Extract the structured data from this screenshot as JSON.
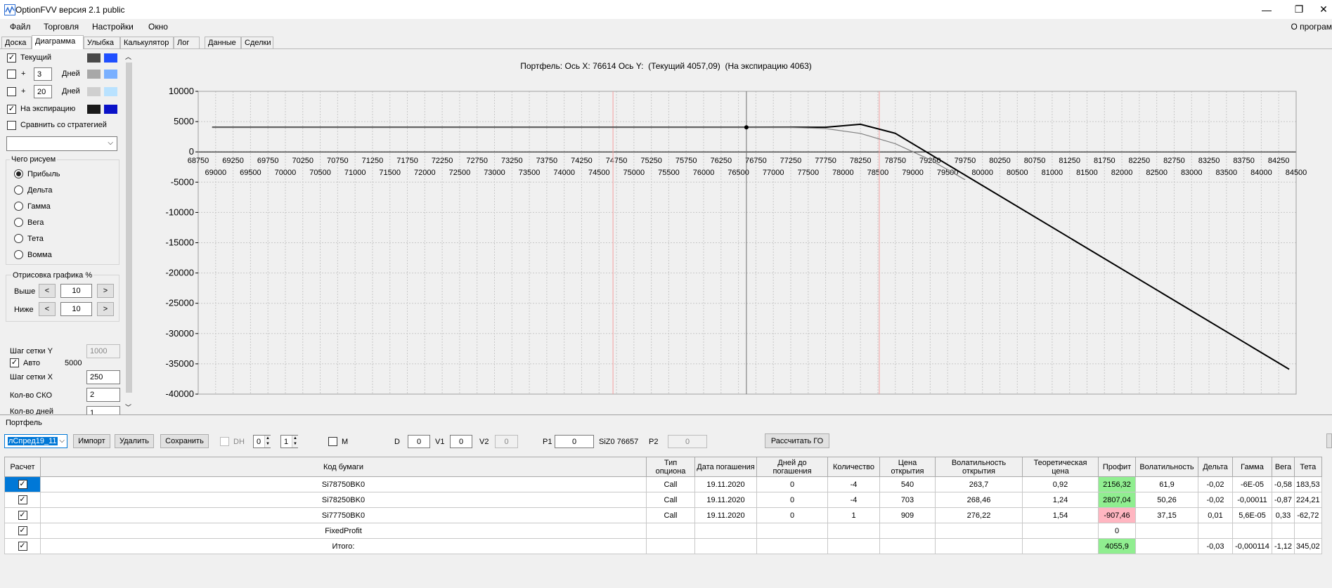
{
  "window": {
    "title": "OptionFVV версия 2.1 public",
    "minimize": "—",
    "maximize": "❐",
    "close": "✕"
  },
  "menu": {
    "items": [
      "Файл",
      "Торговля",
      "Настройки",
      "Окно"
    ],
    "about": "О програм"
  },
  "tabs": [
    "Доска",
    "Диаграмма",
    "Улыбка",
    "Калькулятор",
    "Лог",
    "Данные",
    "Сделки"
  ],
  "active_tab": "Диаграмма",
  "left_panel": {
    "rows": [
      {
        "checked": true,
        "label": "Текущий",
        "colors": [
          "#4a4a4a",
          "#1f4fff"
        ]
      },
      {
        "checked": false,
        "plus": "+",
        "days_value": "3",
        "days_label": "Дней",
        "colors": [
          "#a8a8a8",
          "#7ab0ff"
        ]
      },
      {
        "checked": false,
        "plus": "+",
        "days_value": "20",
        "days_label": "Дней",
        "colors": [
          "#cfcfcf",
          "#b9e2ff"
        ]
      },
      {
        "checked": true,
        "label": "На экспирацию",
        "colors": [
          "#1a1a1a",
          "#0a12c8"
        ]
      }
    ],
    "compare_label": "Сравнить со стратегией",
    "compare_value": "",
    "what_group": {
      "title": "Чего рисуем",
      "options": [
        "Прибыль",
        "Дельта",
        "Гамма",
        "Вега",
        "Тета",
        "Вомма"
      ],
      "selected": "Прибыль"
    },
    "draw_group": {
      "title": "Отрисовка графика %",
      "above_label": "Выше",
      "above_value": "10",
      "below_label": "Ниже",
      "below_value": "10",
      "dec": "<",
      "inc": ">"
    },
    "grid_y_label": "Шаг сетки Y",
    "grid_y_value": "1000",
    "auto_checked": true,
    "auto_label": "Авто",
    "auto_value": "5000",
    "grid_x_label": "Шаг сетки X",
    "grid_x_value": "250",
    "sko_label": "Кол-во СКО",
    "sko_value": "2",
    "days_label": "Кол-во дней",
    "days_value": "1"
  },
  "chart_title": {
    "prefix": "Портфель: Ось X:",
    "x": "76614",
    "y_label": "Ось Y:",
    "current": "(Текущий 4057,09)",
    "expiration": "(На экспирацию 4063)"
  },
  "chart_data": {
    "type": "line",
    "xlim": [
      68750,
      84500
    ],
    "ylim": [
      -40000,
      10000
    ],
    "y_ticks": [
      10000,
      5000,
      0,
      -5000,
      -10000,
      -15000,
      -20000,
      -25000,
      -30000,
      -35000,
      -40000
    ],
    "x_ticks_upper": [
      68750,
      69250,
      69750,
      70250,
      70750,
      71250,
      71750,
      72250,
      72750,
      73250,
      73750,
      74250,
      74750,
      75250,
      75750,
      76250,
      76750,
      77250,
      77750,
      78250,
      78750,
      79250,
      79750,
      80250,
      80750,
      81250,
      81750,
      82250,
      82750,
      83250,
      83750,
      84250
    ],
    "x_ticks_lower": [
      69000,
      69500,
      70000,
      70500,
      71000,
      71500,
      72000,
      72500,
      73000,
      73500,
      74000,
      74500,
      75000,
      75500,
      76000,
      76500,
      77000,
      77500,
      78000,
      78500,
      79000,
      79500,
      80000,
      80500,
      81000,
      81500,
      82000,
      82500,
      83000,
      83500,
      84000,
      84500
    ],
    "grid": true,
    "series": [
      {
        "color": "#000000",
        "x": [
          68950,
          77750,
          78250,
          78750,
          84400
        ],
        "y": [
          4063,
          4063,
          4563,
          3063,
          -35900
        ]
      },
      {
        "color": "#808080",
        "x": [
          68950,
          76614,
          77250,
          77750,
          78250,
          78750,
          79250,
          79750
        ],
        "y": [
          4057,
          4057,
          4030,
          3850,
          3050,
          1350,
          -1300,
          -4600
        ]
      }
    ],
    "markers": [
      {
        "x": 76614,
        "y": 4057
      }
    ],
    "vlines": [
      {
        "x": 74700,
        "color": "#f4a0a0"
      },
      {
        "x": 76614,
        "color": "#707070"
      },
      {
        "x": 78520,
        "color": "#f4a0a0"
      }
    ]
  },
  "portfolio": {
    "label": "Портфель",
    "combo_value": "лСпред19_11",
    "import_btn": "Импорт",
    "delete_btn": "Удалить",
    "save_btn": "Сохранить",
    "dh_label": "DH",
    "spin1": "0",
    "spin2": "1",
    "m_label": "M",
    "d_label": "D",
    "d_value": "0",
    "v1_label": "V1",
    "v1_value": "0",
    "v2_label": "V2",
    "v2_value": "0",
    "p1_label": "P1",
    "p1_value": "0",
    "siz_text": "SiZ0 76657",
    "p2_label": "P2",
    "p2_value": "0",
    "calc_btn": "Рассчитать ГО"
  },
  "table": {
    "headers": [
      "Расчет",
      "Код бумаги",
      "Тип опциона",
      "Дата погашения",
      "Дней до погашения",
      "Количество",
      "Цена открытия",
      "Волатильность открытия",
      "Теоретическая цена",
      "Профит",
      "Волатильность",
      "Дельта",
      "Гамма",
      "Вега",
      "Тета"
    ],
    "rows": [
      {
        "code": "Si78750BK0",
        "type": "Call",
        "date": "19.11.2020",
        "days": "0",
        "qty": "-4",
        "price": "540",
        "vol_open": "263,7",
        "theo": "0,92",
        "profit": "2156,32",
        "profit_color": "green",
        "vol": "61,9",
        "delta": "-0,02",
        "gamma": "-6E-05",
        "vega": "-0,58",
        "theta": "183,53"
      },
      {
        "code": "Si78250BK0",
        "type": "Call",
        "date": "19.11.2020",
        "days": "0",
        "qty": "-4",
        "price": "703",
        "vol_open": "268,46",
        "theo": "1,24",
        "profit": "2807,04",
        "profit_color": "green",
        "vol": "50,26",
        "delta": "-0,02",
        "gamma": "-0,00011",
        "vega": "-0,87",
        "theta": "224,21"
      },
      {
        "code": "Si77750BK0",
        "type": "Call",
        "date": "19.11.2020",
        "days": "0",
        "qty": "1",
        "price": "909",
        "vol_open": "276,22",
        "theo": "1,54",
        "profit": "-907,46",
        "profit_color": "pink",
        "vol": "37,15",
        "delta": "0,01",
        "gamma": "5,6E-05",
        "vega": "0,33",
        "theta": "-62,72"
      },
      {
        "code": "FixedProfit",
        "type": "",
        "date": "",
        "days": "",
        "qty": "",
        "price": "",
        "vol_open": "",
        "theo": "",
        "profit": "0",
        "profit_color": "",
        "vol": "",
        "delta": "",
        "gamma": "",
        "vega": "",
        "theta": ""
      },
      {
        "code": "Итого:",
        "type": "",
        "date": "",
        "days": "",
        "qty": "",
        "price": "",
        "vol_open": "",
        "theo": "",
        "profit": "4055,9",
        "profit_color": "green",
        "vol": "",
        "delta": "-0,03",
        "gamma": "-0,000114",
        "vega": "-1,12",
        "theta": "345,02"
      }
    ]
  }
}
